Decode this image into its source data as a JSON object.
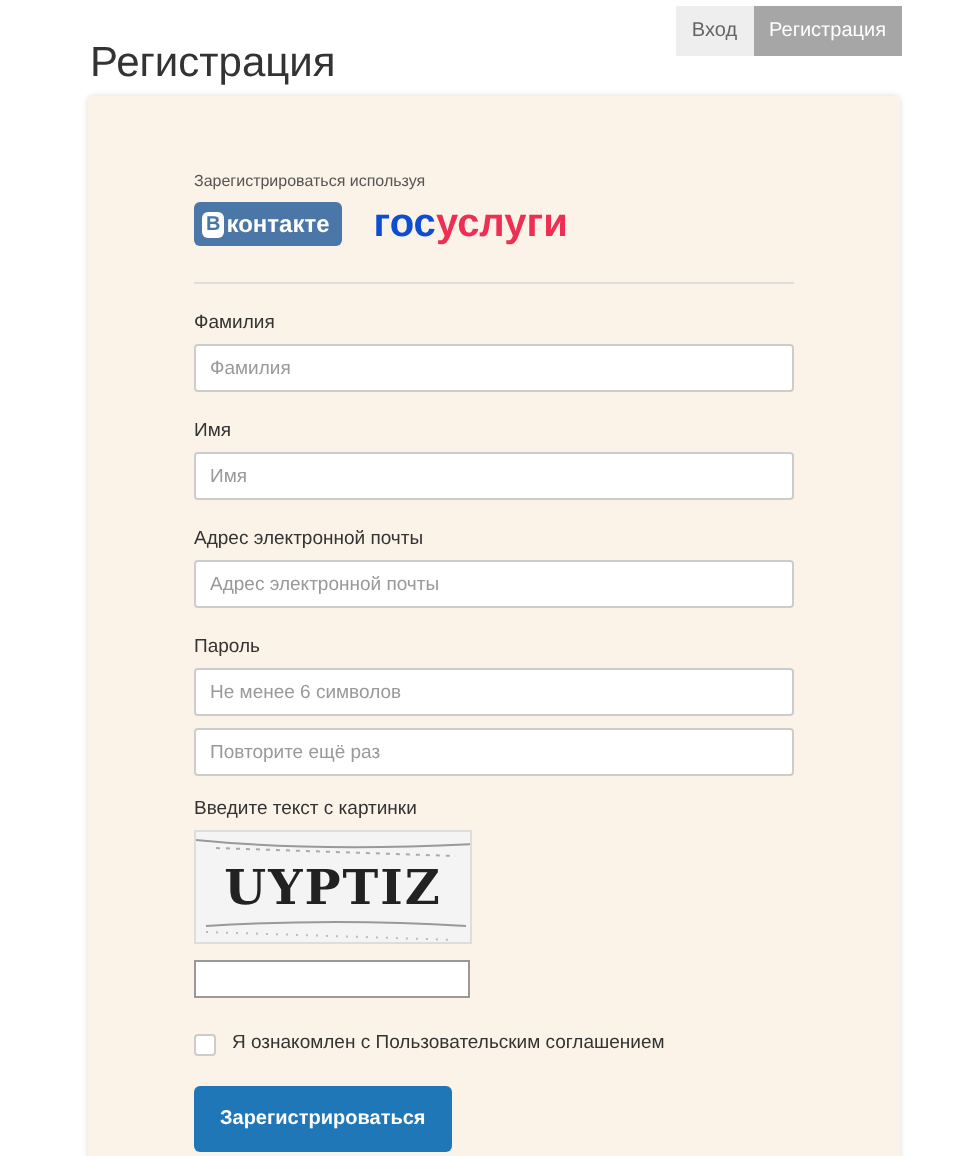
{
  "page_title": "Регистрация",
  "tabs": [
    {
      "label": "Вход",
      "selected": false
    },
    {
      "label": "Регистрация",
      "selected": true
    }
  ],
  "social": {
    "caption": "Зарегистрироваться используя",
    "vk": {
      "badge_letter": "В",
      "label": "контакте"
    },
    "gosuslugi": {
      "prefix": "гос",
      "rest": "услуги"
    }
  },
  "fields": [
    {
      "label": "Фамилия",
      "placeholder": "Фамилия"
    },
    {
      "label": "Имя",
      "placeholder": "Имя"
    },
    {
      "label": "Адрес электронной почты",
      "placeholder": "Адрес электронной почты"
    },
    {
      "label": "Пароль",
      "placeholder": "Не менее 6 символов"
    },
    {
      "placeholder": "Повторите ещё раз"
    }
  ],
  "captcha": {
    "label": "Введите текст с картинки",
    "text": "UYPTIZ"
  },
  "agreement": {
    "checked": false,
    "text": "Я ознакомлен с",
    "link": "Пользовательским соглашением"
  },
  "submit": "Зарегистрироваться"
}
